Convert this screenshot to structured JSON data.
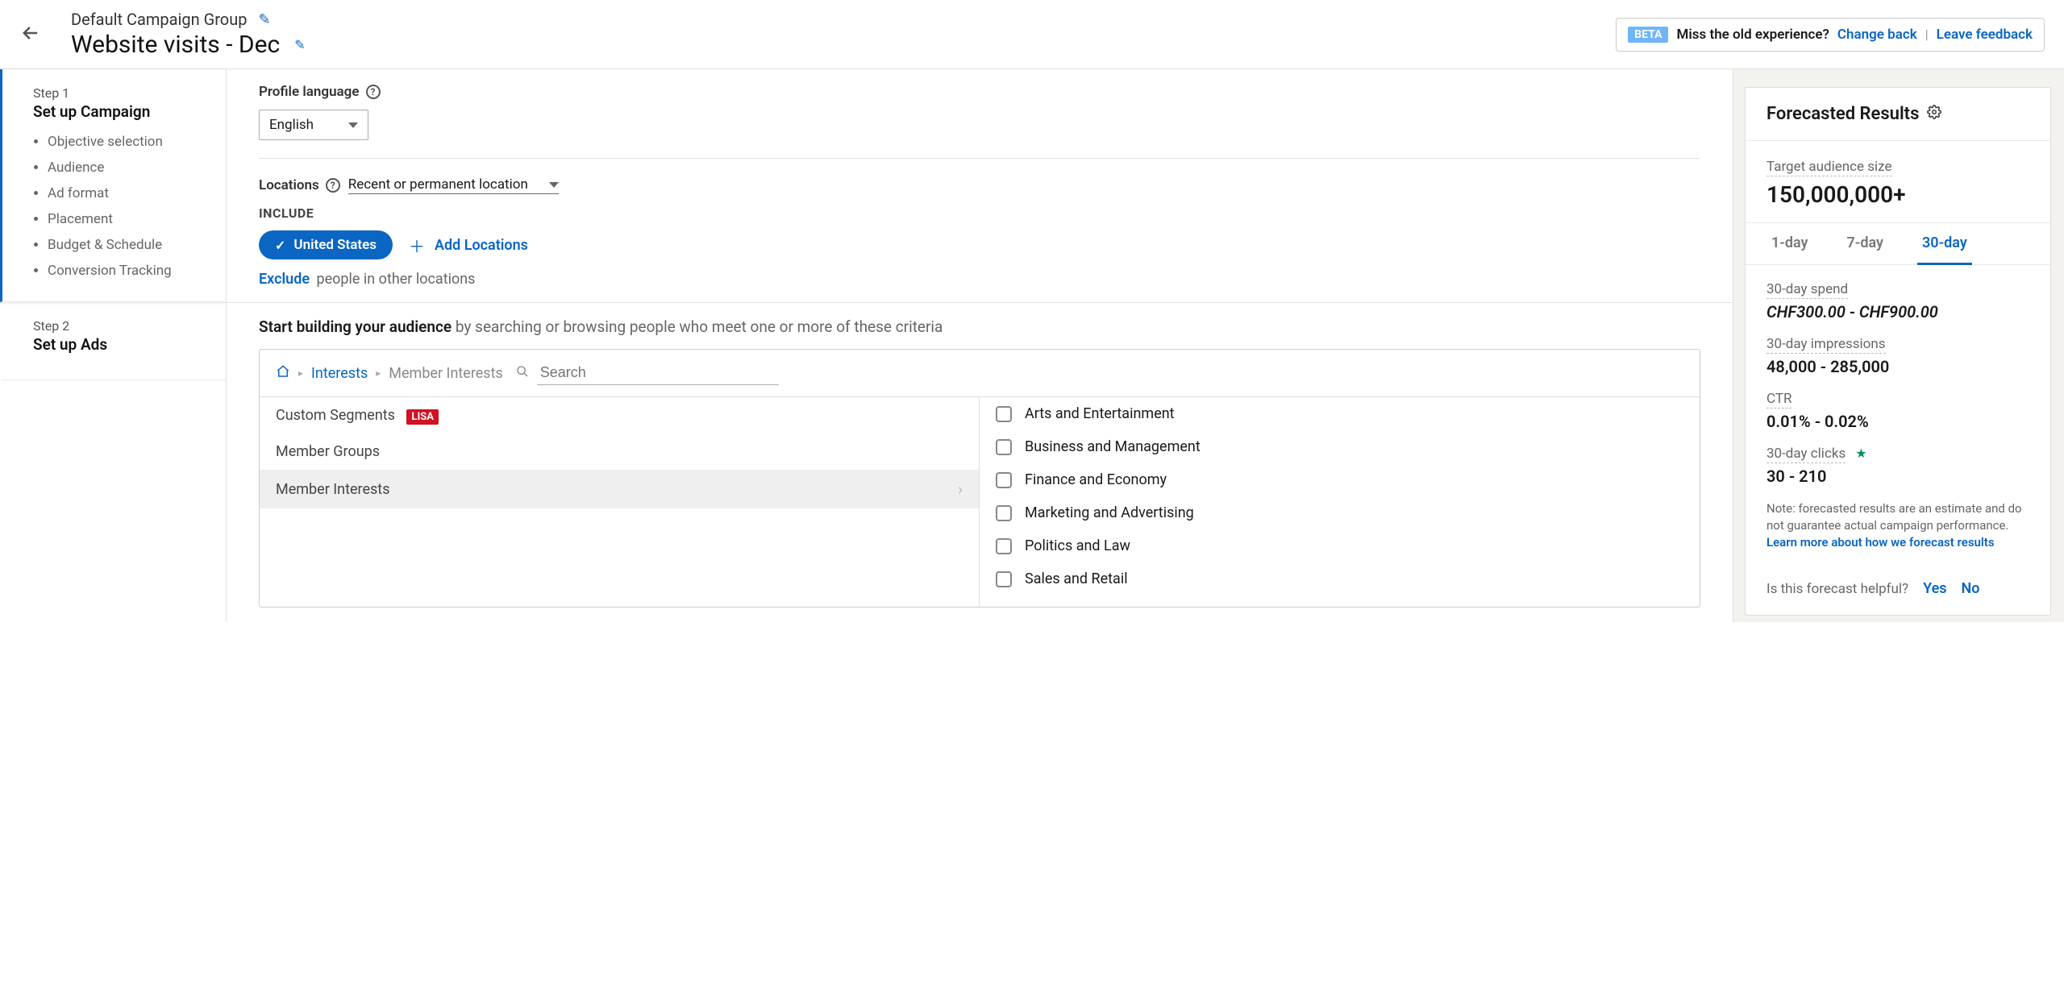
{
  "header": {
    "campaign_group": "Default Campaign Group",
    "campaign_name": "Website visits - Dec",
    "beta": "BETA",
    "miss_text": "Miss the old experience?",
    "change_back": "Change back",
    "leave_feedback": "Leave feedback"
  },
  "sidebar": {
    "step1_label": "Step 1",
    "step1_title": "Set up Campaign",
    "step1_items": [
      "Objective selection",
      "Audience",
      "Ad format",
      "Placement",
      "Budget & Schedule",
      "Conversion Tracking"
    ],
    "step2_label": "Step 2",
    "step2_title": "Set up Ads"
  },
  "profile": {
    "label": "Profile language",
    "value": "English"
  },
  "locations": {
    "label": "Locations",
    "option_label": "Recent or permanent location",
    "include_label": "INCLUDE",
    "selected": "United States",
    "add_label": "Add Locations",
    "exclude_link": "Exclude",
    "exclude_rest": "people in other locations"
  },
  "audience": {
    "heading_bold": "Start building your audience",
    "heading_rest": "by searching or browsing people who meet one or more of these criteria",
    "crumb1": "Interests",
    "crumb2": "Member Interests",
    "search_placeholder": "Search",
    "left": {
      "custom": "Custom Segments",
      "lisa": "LISA",
      "groups": "Member Groups",
      "interests": "Member Interests"
    },
    "right": [
      "Arts and Entertainment",
      "Business and Management",
      "Finance and Economy",
      "Marketing and Advertising",
      "Politics and Law",
      "Sales and Retail"
    ]
  },
  "forecast": {
    "title": "Forecasted Results",
    "audience_size_label": "Target audience size",
    "audience_size": "150,000,000+",
    "tabs": {
      "d1": "1-day",
      "d7": "7-day",
      "d30": "30-day"
    },
    "spend_label": "30-day spend",
    "spend": "CHF300.00 - CHF900.00",
    "impressions_label": "30-day impressions",
    "impressions": "48,000 - 285,000",
    "ctr_label": "CTR",
    "ctr": "0.01% - 0.02%",
    "clicks_label": "30-day clicks",
    "clicks": "30 - 210",
    "note": "Note: forecasted results are an estimate and do not guarantee actual campaign performance.",
    "note_link": "Learn more about how we forecast results",
    "helpful_q": "Is this forecast helpful?",
    "yes": "Yes",
    "no": "No"
  }
}
